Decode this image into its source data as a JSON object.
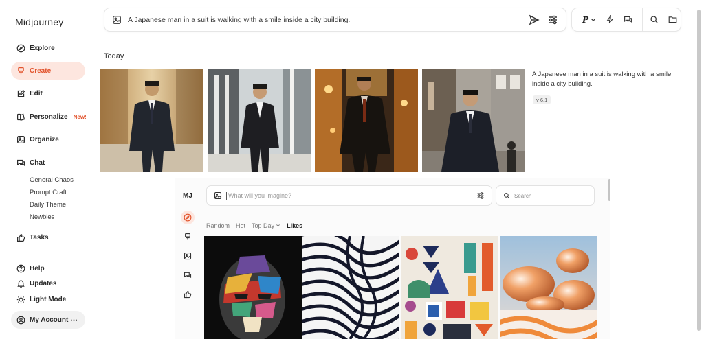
{
  "app": {
    "title": "Midjourney"
  },
  "sidebar": {
    "items": [
      {
        "label": "Explore",
        "icon": "compass-icon"
      },
      {
        "label": "Create",
        "icon": "brush-icon",
        "active": true
      },
      {
        "label": "Edit",
        "icon": "edit-icon"
      },
      {
        "label": "Personalize",
        "icon": "personalize-icon",
        "badge": "New!"
      },
      {
        "label": "Organize",
        "icon": "image-icon"
      },
      {
        "label": "Chat",
        "icon": "chat-icon"
      }
    ],
    "chat_rooms": [
      "General Chaos",
      "Prompt Craft",
      "Daily Theme",
      "Newbies"
    ],
    "tasks": "Tasks",
    "help": "Help",
    "updates": "Updates",
    "light_mode": "Light Mode",
    "account": "My Account",
    "account_menu": "⋯"
  },
  "topbar": {
    "prompt": "A Japanese man in a suit is walking with a smile inside a city building.",
    "personalize_label": "P"
  },
  "today": {
    "heading": "Today",
    "caption": "A Japanese man in a suit is walking with a smile inside a city building.",
    "version": "v 6.1"
  },
  "embedded": {
    "logo": "MJ",
    "imagine_placeholder": "What will you imagine?",
    "search_placeholder": "Search",
    "filters": [
      "Random",
      "Hot",
      "Top Day",
      "Likes"
    ],
    "active_filter": "Likes"
  },
  "colors": {
    "accent": "#e2532c",
    "accent_bg": "#fde6df"
  }
}
